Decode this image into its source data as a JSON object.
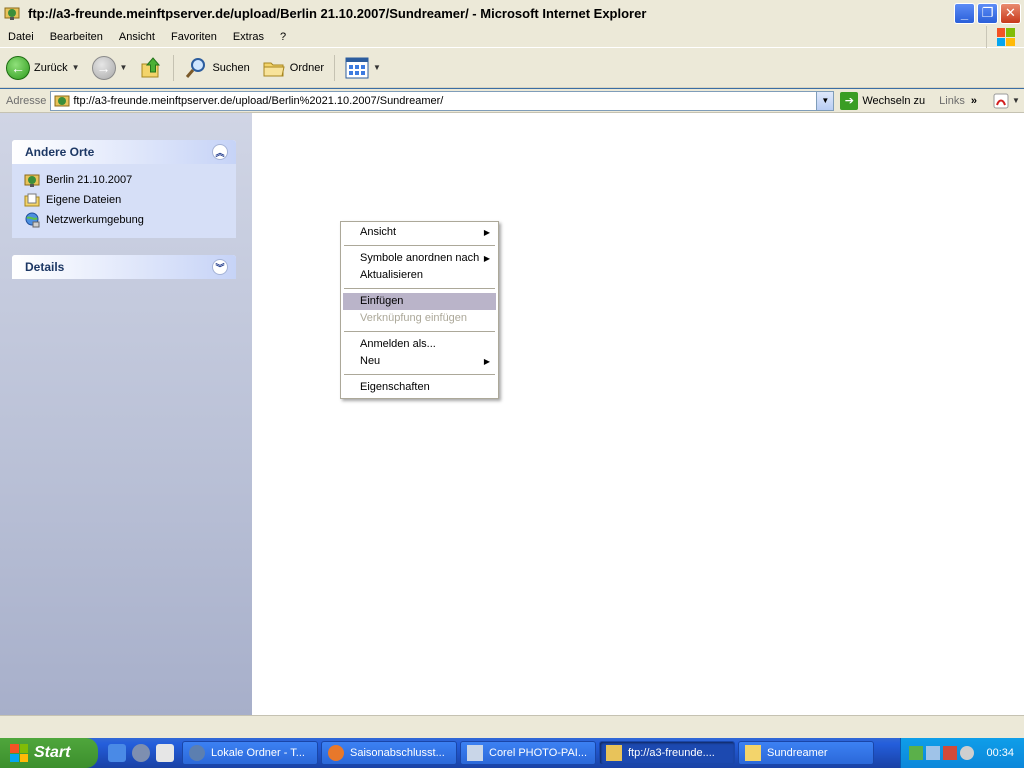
{
  "window": {
    "title": "ftp://a3-freunde.meinftpserver.de/upload/Berlin 21.10.2007/Sundreamer/ - Microsoft Internet Explorer",
    "app_icon": "ftp-folder-icon",
    "buttons": [
      "minimize",
      "restore",
      "close"
    ]
  },
  "menubar": {
    "items": [
      "Datei",
      "Bearbeiten",
      "Ansicht",
      "Favoriten",
      "Extras",
      "?"
    ]
  },
  "toolbar": {
    "back_label": "Zurück",
    "search_label": "Suchen",
    "folders_label": "Ordner"
  },
  "addressbar": {
    "label": "Adresse",
    "url": "ftp://a3-freunde.meinftpserver.de/upload/Berlin%2021.10.2007/Sundreamer/",
    "go_label": "Wechseln zu",
    "links_label": "Links"
  },
  "sidebar": {
    "other_places": {
      "title": "Andere Orte",
      "items": [
        {
          "label": "Berlin 21.10.2007",
          "icon": "ftp-folder-icon"
        },
        {
          "label": "Eigene Dateien",
          "icon": "documents-folder-icon"
        },
        {
          "label": "Netzwerkumgebung",
          "icon": "network-icon"
        }
      ]
    },
    "details": {
      "title": "Details"
    }
  },
  "context_menu": {
    "items": [
      {
        "label": "Ansicht",
        "submenu": true,
        "disabled": false
      },
      {
        "separator": true
      },
      {
        "label": "Symbole anordnen nach",
        "submenu": true,
        "disabled": false
      },
      {
        "label": "Aktualisieren",
        "submenu": false,
        "disabled": false
      },
      {
        "separator": true
      },
      {
        "label": "Einfügen",
        "submenu": false,
        "disabled": false,
        "selected": true
      },
      {
        "label": "Verknüpfung einfügen",
        "submenu": false,
        "disabled": true
      },
      {
        "separator": true
      },
      {
        "label": "Anmelden als...",
        "submenu": false,
        "disabled": false
      },
      {
        "label": "Neu",
        "submenu": true,
        "disabled": false
      },
      {
        "separator": true
      },
      {
        "label": "Eigenschaften",
        "submenu": false,
        "disabled": false
      }
    ]
  },
  "taskbar": {
    "start_label": "Start",
    "tasks": [
      {
        "label": "Lokale Ordner - T...",
        "icon": "thunderbird-icon",
        "active": false
      },
      {
        "label": "Saisonabschlusst...",
        "icon": "firefox-icon",
        "active": false
      },
      {
        "label": "Corel PHOTO-PAI...",
        "icon": "corel-icon",
        "active": false
      },
      {
        "label": "ftp://a3-freunde....",
        "icon": "ftp-folder-icon",
        "active": true
      },
      {
        "label": "Sundreamer",
        "icon": "folder-icon",
        "active": false
      }
    ],
    "clock": "00:34"
  },
  "colors": {
    "selection": "#bab4c9",
    "disabled_text": "#aca899",
    "taskbar_blue": "#245edb",
    "start_green": "#3c8f2d"
  }
}
